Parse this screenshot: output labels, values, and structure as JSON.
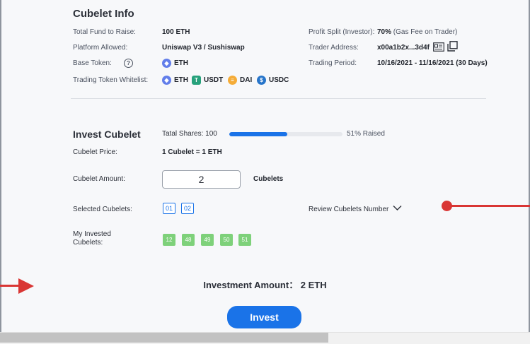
{
  "info": {
    "title": "Cubelet Info",
    "total_fund_label": "Total Fund to Raise:",
    "total_fund_value": "100 ETH",
    "platform_label": "Platform Allowed:",
    "platform_value": "Uniswap V3 / Sushiswap",
    "base_token_label": "Base Token:",
    "base_token_value": "ETH",
    "whitelist_label": "Trading Token Whitelist:",
    "whitelist": [
      {
        "symbol": "ETH",
        "icon": "eth-icon",
        "color": "#627eea"
      },
      {
        "symbol": "USDT",
        "icon": "usdt-icon",
        "color": "#26a17b"
      },
      {
        "symbol": "DAI",
        "icon": "dai-icon",
        "color": "#f5ac37"
      },
      {
        "symbol": "USDC",
        "icon": "usdc-icon",
        "color": "#2775ca"
      }
    ],
    "profit_split_label": "Profit Split (Investor):",
    "profit_split_value": "70%",
    "profit_split_note": "(Gas Fee on Trader)",
    "trader_address_label": "Trader Address:",
    "trader_address_value": "x00a1b2x...3d4f",
    "trading_period_label": "Trading Period:",
    "trading_period_value": "10/16/2021 - 11/16/2021 (30 Days)"
  },
  "invest": {
    "title": "Invest Cubelet",
    "total_shares_label": "Tatal Shares: 100",
    "raised_percent": 51,
    "raised_label": "51% Raised",
    "price_label": "Cubelet Price:",
    "price_value": "1 Cubelet = 1 ETH",
    "amount_label": "Cubelet Amount:",
    "amount_value": "2",
    "amount_unit": "Cubelets",
    "selected_label": "Selected Cubelets:",
    "selected": [
      "01",
      "02"
    ],
    "review_label": "Review Cubelets Number",
    "my_invested_label_1": "My Invested",
    "my_invested_label_2": "Cubelets:",
    "my_invested": [
      "12",
      "48",
      "49",
      "50",
      "51"
    ],
    "investment_amount": "Investment Amount： 2 ETH",
    "invest_button": "Invest"
  },
  "colors": {
    "accent": "#1a73e8",
    "invested_chip": "#7ed17a",
    "annotation": "#d93634"
  }
}
